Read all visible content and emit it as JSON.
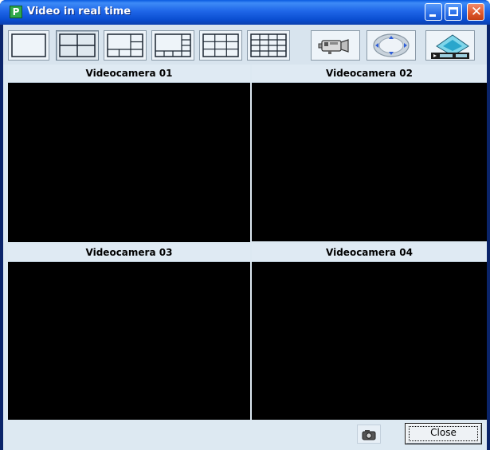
{
  "window": {
    "title": "Video in real time",
    "app_icon_letter": "P",
    "close_glyph": "✕"
  },
  "toolbar": {
    "layouts": [
      {
        "name": "layout-1x1",
        "icon": "grid-1x1-icon"
      },
      {
        "name": "layout-2x2",
        "icon": "grid-2x2-icon",
        "active": true
      },
      {
        "name": "layout-1-plus-5",
        "icon": "grid-1plus5-icon"
      },
      {
        "name": "layout-1-plus-7",
        "icon": "grid-1plus7-icon"
      },
      {
        "name": "layout-3x3",
        "icon": "grid-3x3-icon"
      },
      {
        "name": "layout-4x4",
        "icon": "grid-4x4-icon"
      }
    ],
    "camera_tool_icon": "video-camera-icon",
    "ptz_tool_icon": "ptz-joystick-icon",
    "playback_tool_icon": "film-playback-icon"
  },
  "panels": [
    {
      "label": "Videocamera 01",
      "selected": true
    },
    {
      "label": "Videocamera 02",
      "selected": false
    },
    {
      "label": "Videocamera 03",
      "selected": false
    },
    {
      "label": "Videocamera 04",
      "selected": false
    }
  ],
  "footer": {
    "snapshot_icon": "camera-snapshot-icon",
    "close_label": "Close"
  },
  "colors": {
    "selected_outline": "#33d42e",
    "titlebar": "#1f66e8",
    "client_bg": "#dde9f2"
  }
}
